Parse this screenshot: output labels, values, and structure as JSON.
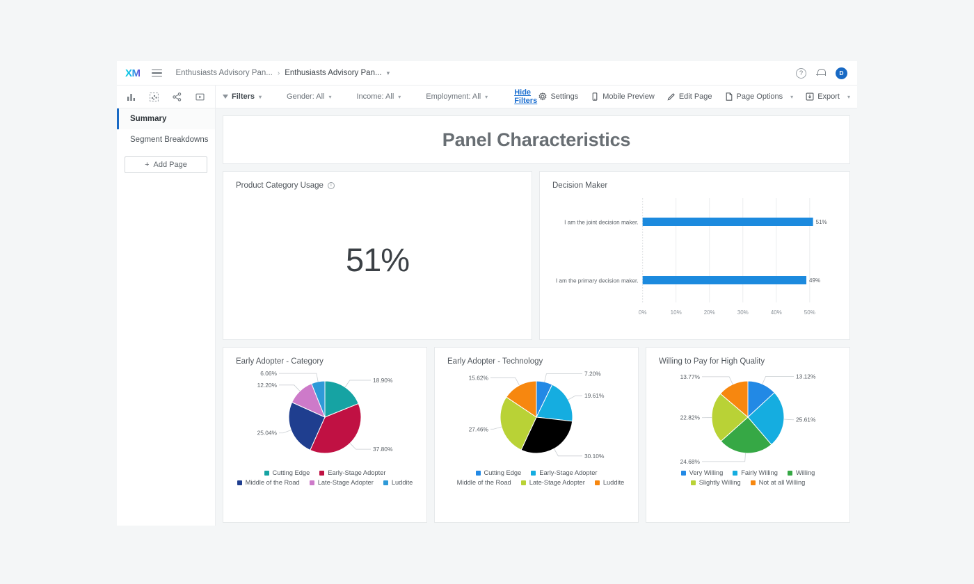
{
  "topbar": {
    "logo": "XM",
    "breadcrumb_1": "Enthusiasts Advisory Pan...",
    "breadcrumb_sep": "›",
    "breadcrumb_2": "Enthusiasts Advisory Pan...",
    "help_label": "?",
    "avatar_initial": "D"
  },
  "toolbar": {
    "filters_label": "Filters",
    "gender_label": "Gender:  All",
    "income_label": "Income:  All",
    "employment_label": "Employment:  All",
    "hide_filters_label": "Hide Filters",
    "settings_label": "Settings",
    "mobile_preview_label": "Mobile Preview",
    "edit_page_label": "Edit Page",
    "page_options_label": "Page Options",
    "export_label": "Export"
  },
  "sidebar": {
    "items": [
      {
        "label": "Summary",
        "active": true
      },
      {
        "label": "Segment Breakdowns",
        "active": false
      }
    ],
    "add_page_label": "Add Page"
  },
  "page": {
    "title": "Panel Characteristics"
  },
  "widgets": {
    "product_category": {
      "title": "Product Category Usage",
      "value": "51%"
    },
    "decision_maker": {
      "title": "Decision Maker"
    }
  },
  "colors": {
    "accent_blue": "#1c8ade",
    "link_blue": "#1c6fd0",
    "bar_blue": "#1c8ade"
  },
  "chart_data": [
    {
      "type": "bar",
      "orientation": "horizontal",
      "title": "Decision Maker",
      "categories": [
        "I am the joint decision maker.",
        "I am the primary decision maker."
      ],
      "values": [
        51,
        49
      ],
      "value_labels": [
        "51%",
        "49%"
      ],
      "xlabel": "",
      "ylabel": "",
      "xlim": [
        0,
        55
      ],
      "xticks": [
        "0%",
        "10%",
        "20%",
        "30%",
        "40%",
        "50%"
      ],
      "xtick_values": [
        0,
        10,
        20,
        30,
        40,
        50
      ],
      "grid": true,
      "series_color": "#1c8ade",
      "legend": "none"
    },
    {
      "type": "pie",
      "title": "Early Adopter - Category",
      "labels": [
        "Cutting Edge",
        "Early-Stage Adopter",
        "Middle of the Road",
        "Late-Stage Adopter",
        "Luddite"
      ],
      "values": [
        18.9,
        37.8,
        25.04,
        12.2,
        6.06
      ],
      "value_labels": [
        "18.90%",
        "37.80%",
        "25.04%",
        "12.20%",
        "6.06%"
      ],
      "colors": [
        "#16a3a3",
        "#c01143",
        "#1f3e8f",
        "#cd7ac9",
        "#2e9ad8"
      ],
      "legend_position": "bottom"
    },
    {
      "type": "pie",
      "title": "Early Adopter - Technology",
      "labels": [
        "Cutting Edge",
        "Early-Stage Adopter",
        "Middle of the Road",
        "Late-Stage Adopter",
        "Luddite"
      ],
      "values": [
        7.2,
        19.61,
        30.1,
        27.46,
        15.62
      ],
      "value_labels": [
        "7.20%",
        "19.61%",
        "30.10%",
        "27.46%",
        "15.62%"
      ],
      "colors": [
        "#2289e5",
        "#15ade0",
        "#3aa council",
        "#b9d236",
        "#f7870f"
      ],
      "legend_position": "bottom"
    },
    {
      "type": "pie",
      "title": "Willing to Pay for High Quality",
      "labels": [
        "Very Willing",
        "Fairly Willing",
        "Willing",
        "Slightly Willing",
        "Not at all Willing"
      ],
      "values": [
        13.12,
        25.61,
        24.68,
        22.82,
        13.77
      ],
      "value_labels": [
        "13.12%",
        "25.61%",
        "24.68%",
        "22.82%",
        "13.77%"
      ],
      "colors": [
        "#2289e5",
        "#15ade0",
        "#36a845",
        "#b9d236",
        "#f7870f"
      ],
      "legend_position": "bottom"
    }
  ]
}
